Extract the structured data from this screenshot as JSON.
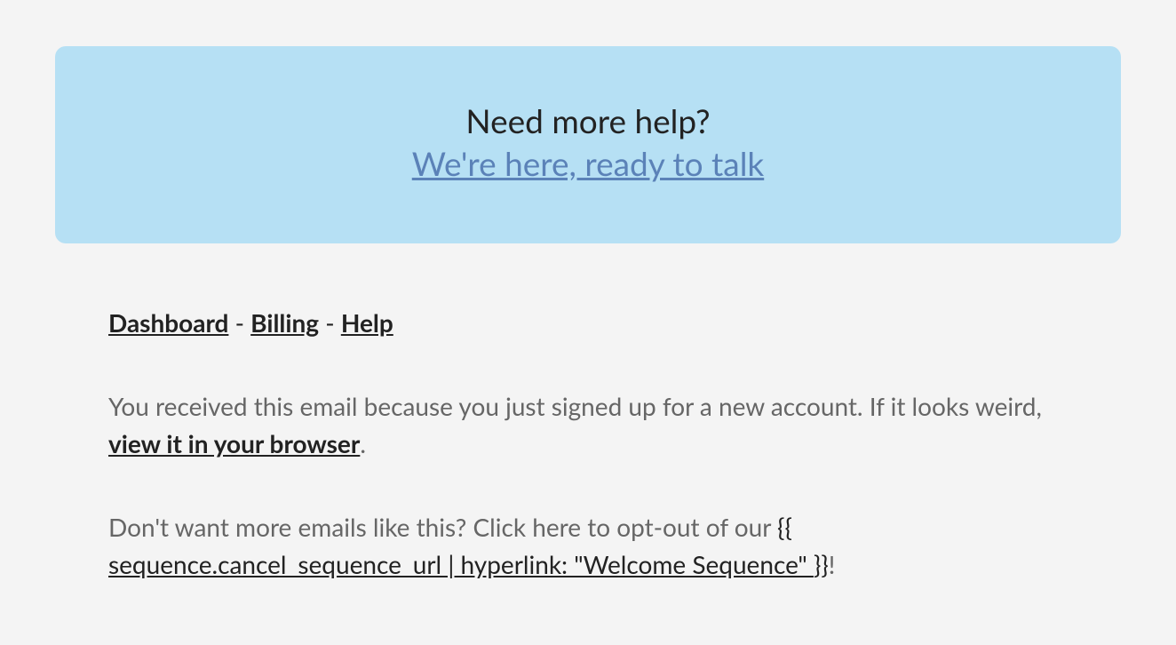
{
  "help_banner": {
    "title": "Need more help?",
    "link_text": "We're here, ready to talk"
  },
  "footer_nav": {
    "dashboard": "Dashboard",
    "billing": "Billing",
    "help": "Help",
    "separator": " - "
  },
  "reason_paragraph": {
    "text_before": "You received this email because you just signed up for a new account. If it looks weird, ",
    "view_browser_link": "view it in your browser",
    "text_after": "."
  },
  "optout_paragraph": {
    "text_before": "Don't want more emails like this? Click here to opt-out of our ",
    "template_open": "{{ ",
    "sequence_link": "sequence.cancel_sequence_url | hyperlink: \"Welcome Sequence\" ",
    "template_close": "}}",
    "text_after": "!"
  }
}
